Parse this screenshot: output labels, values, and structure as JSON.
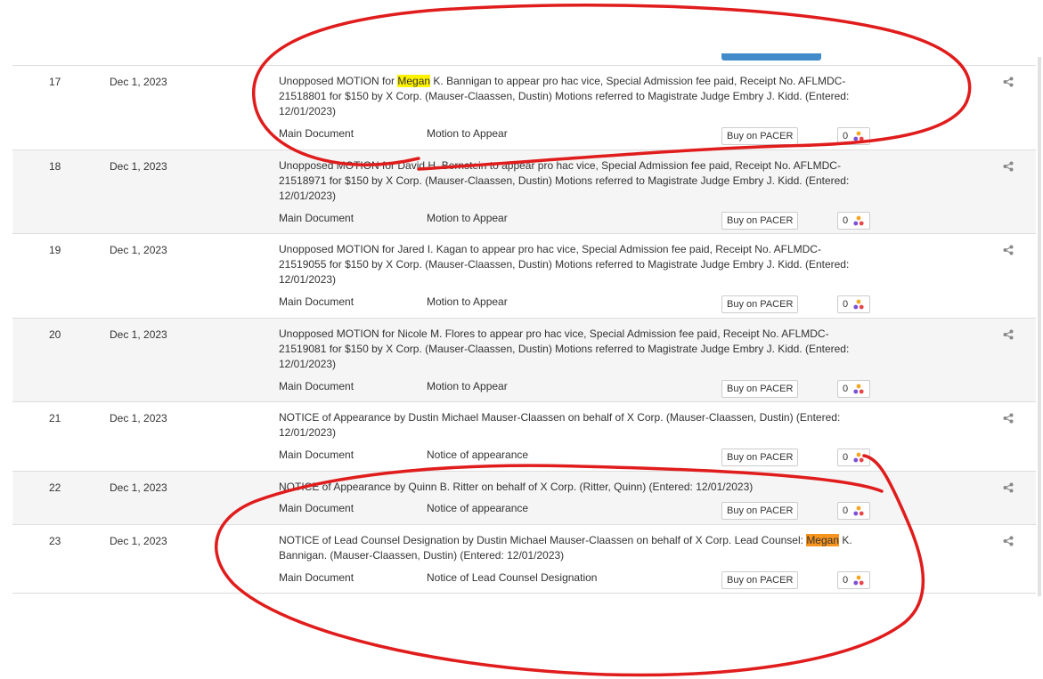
{
  "docket": {
    "entries": [
      {
        "number": "17",
        "date": "Dec 1, 2023",
        "desc_before": "Unopposed MOTION for ",
        "desc_highlight": "Megan",
        "desc_after": " K. Bannigan to appear pro hac vice, Special Admission fee paid, Receipt No. AFLMDC-21518801 for $150 by X Corp. (Mauser-Claassen, Dustin) Motions referred to Magistrate Judge Embry J. Kidd. (Entered: 12/01/2023)",
        "doc_name": "Main Document",
        "doc_type": "Motion to Appear",
        "pacer_label": "Buy on PACER",
        "count": "0"
      },
      {
        "number": "18",
        "date": "Dec 1, 2023",
        "desc_before": "Unopposed MOTION for David H. Bernstein to appear pro hac vice, Special Admission fee paid, Receipt No. AFLMDC-21518971 for $150 by X Corp. (Mauser-Claassen, Dustin) Motions referred to Magistrate Judge Embry J. Kidd. (Entered: 12/01/2023)",
        "doc_name": "Main Document",
        "doc_type": "Motion to Appear",
        "pacer_label": "Buy on PACER",
        "count": "0"
      },
      {
        "number": "19",
        "date": "Dec 1, 2023",
        "desc_before": "Unopposed MOTION for Jared I. Kagan to appear pro hac vice, Special Admission fee paid, Receipt No. AFLMDC-21519055 for $150 by X Corp. (Mauser-Claassen, Dustin) Motions referred to Magistrate Judge Embry J. Kidd. (Entered: 12/01/2023)",
        "doc_name": "Main Document",
        "doc_type": "Motion to Appear",
        "pacer_label": "Buy on PACER",
        "count": "0"
      },
      {
        "number": "20",
        "date": "Dec 1, 2023",
        "desc_before": "Unopposed MOTION for Nicole M. Flores to appear pro hac vice, Special Admission fee paid, Receipt No. AFLMDC-21519081 for $150 by X Corp. (Mauser-Claassen, Dustin) Motions referred to Magistrate Judge Embry J. Kidd. (Entered: 12/01/2023)",
        "doc_name": "Main Document",
        "doc_type": "Motion to Appear",
        "pacer_label": "Buy on PACER",
        "count": "0"
      },
      {
        "number": "21",
        "date": "Dec 1, 2023",
        "desc_before": "NOTICE of Appearance by Dustin Michael Mauser-Claassen on behalf of X Corp. (Mauser-Claassen, Dustin) (Entered: 12/01/2023)",
        "doc_name": "Main Document",
        "doc_type": "Notice of appearance",
        "pacer_label": "Buy on PACER",
        "count": "0"
      },
      {
        "number": "22",
        "date": "Dec 1, 2023",
        "desc_before": "NOTICE of Appearance by Quinn B. Ritter on behalf of X Corp. (Ritter, Quinn) (Entered: 12/01/2023)",
        "doc_name": "Main Document",
        "doc_type": "Notice of appearance",
        "pacer_label": "Buy on PACER",
        "count": "0"
      },
      {
        "number": "23",
        "date": "Dec 1, 2023",
        "desc_before": "NOTICE of Lead Counsel Designation by Dustin Michael Mauser-Claassen on behalf of X Corp. Lead Counsel: ",
        "desc_highlight": "Megan",
        "desc_after": " K. Bannigan. (Mauser-Claassen, Dustin) (Entered: 12/01/2023)",
        "doc_name": "Main Document",
        "doc_type": "Notice of Lead Counsel Designation",
        "pacer_label": "Buy on PACER",
        "count": "0"
      }
    ]
  },
  "icons": {
    "share": "share-icon",
    "logo": "tri-color-logo-icon"
  },
  "colors": {
    "highlight_yellow": "#fff200",
    "highlight_orange": "#f7941d",
    "annotation_red": "#e01c1c",
    "row_alt_bg": "#f5f5f5"
  }
}
